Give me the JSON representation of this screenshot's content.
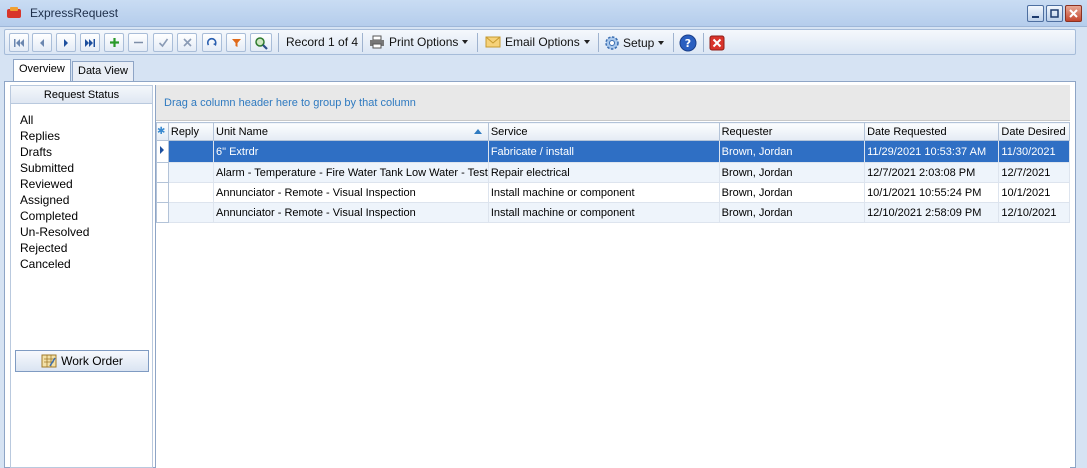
{
  "window": {
    "title": "ExpressRequest"
  },
  "toolbar": {
    "record_label": "Record 1 of 4",
    "print_options": "Print Options",
    "email_options": "Email Options",
    "setup": "Setup"
  },
  "tabs": [
    {
      "label": "Overview",
      "active": true
    },
    {
      "label": "Data View",
      "active": false
    }
  ],
  "left_panel": {
    "header": "Request Status",
    "items": [
      "All",
      "Replies",
      "Drafts",
      "Submitted",
      "Reviewed",
      "Assigned",
      "Completed",
      "Un-Resolved",
      "Rejected",
      "Canceled"
    ],
    "work_order_button": "Work Order"
  },
  "grid": {
    "group_hint": "Drag a column header here to group by that column",
    "columns": [
      "Reply",
      "Unit Name",
      "Service",
      "Requester",
      "Date Requested",
      "Date Desired"
    ],
    "rows": [
      [
        "",
        "6\" Extrdr",
        "Fabricate / install",
        "Brown, Jordan",
        "11/29/2021 10:53:37 AM",
        "11/30/2021"
      ],
      [
        "",
        "Alarm - Temperature - Fire Water Tank Low Water - Test",
        "Repair electrical",
        "Brown, Jordan",
        "12/7/2021 2:03:08 PM",
        "12/7/2021"
      ],
      [
        "",
        "Annunciator - Remote - Visual Inspection",
        "Install machine or component",
        "Brown, Jordan",
        "10/1/2021 10:55:24 PM",
        "10/1/2021"
      ],
      [
        "",
        "Annunciator - Remote - Visual Inspection",
        "Install machine or component",
        "Brown, Jordan",
        "12/10/2021 2:58:09 PM",
        "12/10/2021"
      ]
    ]
  },
  "colors": {
    "selection": "#2f6fc4",
    "group_hint": "#2f7ac0",
    "chrome": "#d6e3f3"
  }
}
